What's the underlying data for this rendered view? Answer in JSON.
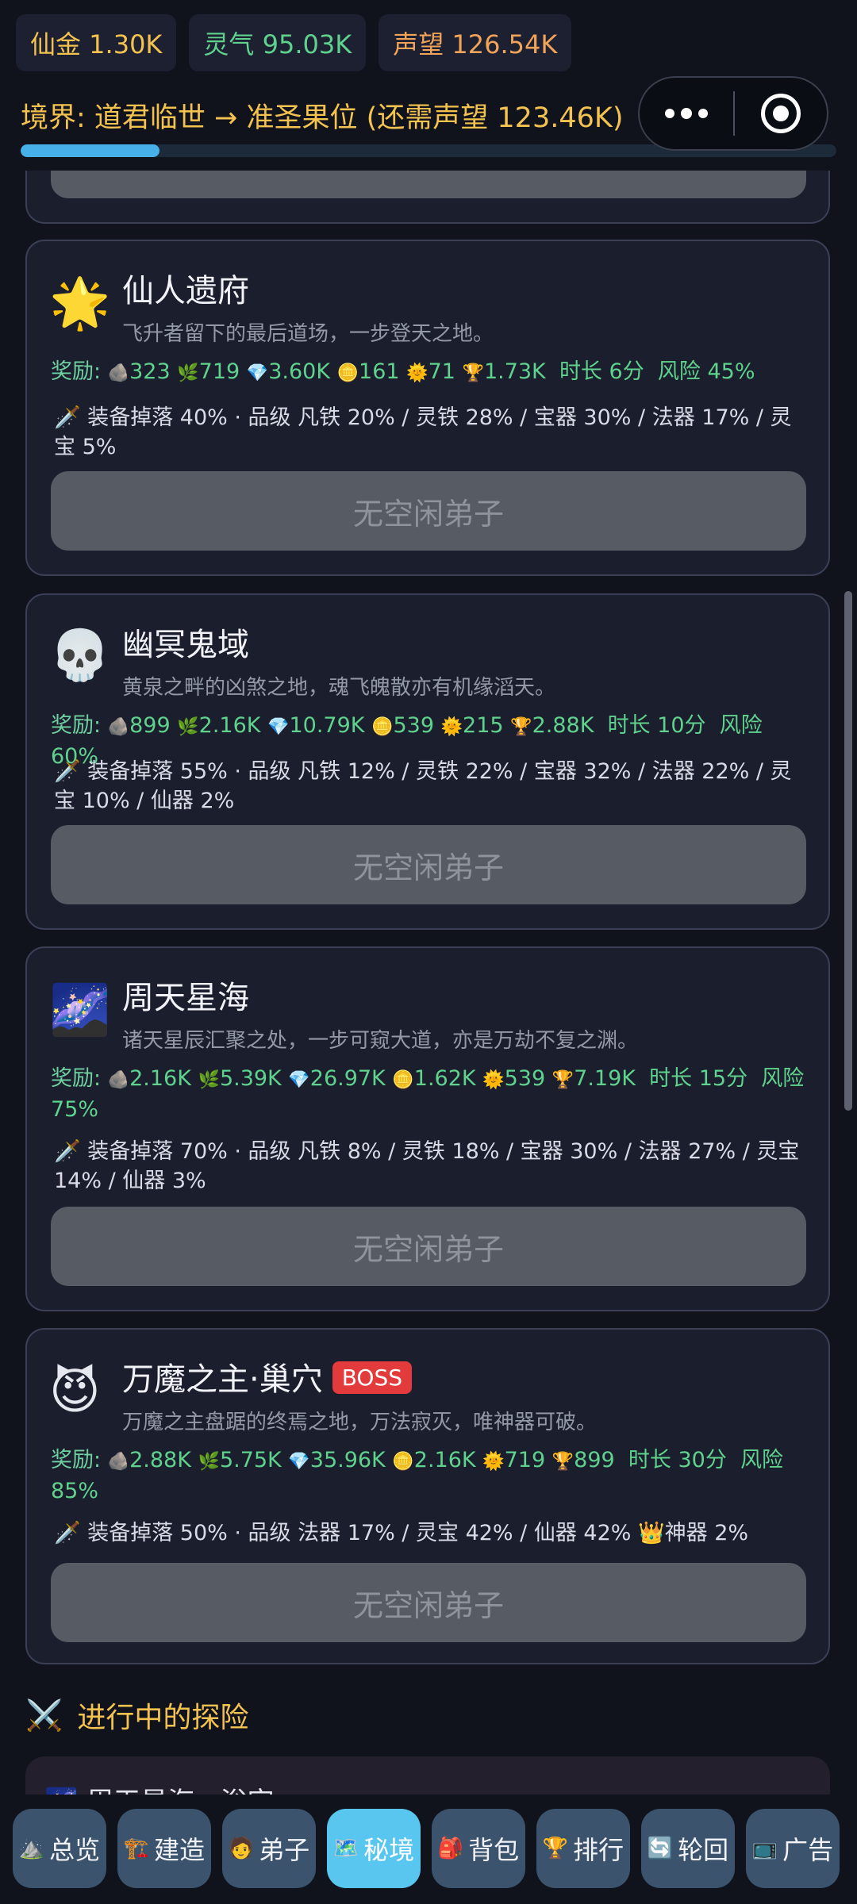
{
  "resources": [
    {
      "label": "仙金 1.30K",
      "color": "gold"
    },
    {
      "label": "灵气 95.03K",
      "color": "green"
    },
    {
      "label": "声望 126.54K",
      "color": "orange"
    }
  ],
  "realm": {
    "text": "境界: 道君临世 → 准圣果位 (还需声望 123.46K)",
    "progress_percent": 17
  },
  "busy_label": "无空闲弟子",
  "realms": [
    {
      "icon": "🌟",
      "icon_name": "glowing-star-icon",
      "title": "仙人遗府",
      "desc": "飞升者留下的最后道场，一步登天之地。",
      "reward_label": "奖励:",
      "rewards": [
        {
          "icon": "🪨",
          "value": "323"
        },
        {
          "icon": "🌿",
          "value": "719"
        },
        {
          "icon": "💎",
          "value": "3.60K"
        },
        {
          "icon": "🪙",
          "value": "161"
        },
        {
          "icon": "🌞",
          "value": "71"
        },
        {
          "icon": "🏆",
          "value": "1.73K"
        }
      ],
      "duration": "时长 6分",
      "risk": "风险 45%",
      "drop": "🗡️ 装备掉落 40% · 品级 凡铁 20% / 灵铁 28% / 宝器 30% / 法器 17% / 灵宝 5%"
    },
    {
      "icon": "💀",
      "icon_name": "skull-icon",
      "title": "幽冥鬼域",
      "desc": "黄泉之畔的凶煞之地，魂飞魄散亦有机缘滔天。",
      "reward_label": "奖励:",
      "rewards": [
        {
          "icon": "🪨",
          "value": "899"
        },
        {
          "icon": "🌿",
          "value": "2.16K"
        },
        {
          "icon": "💎",
          "value": "10.79K"
        },
        {
          "icon": "🪙",
          "value": "539"
        },
        {
          "icon": "🌞",
          "value": "215"
        },
        {
          "icon": "🏆",
          "value": "2.88K"
        }
      ],
      "duration": "时长 10分",
      "risk": "风险 60%",
      "drop": "🗡️ 装备掉落 55% · 品级 凡铁 12% / 灵铁 22% / 宝器 32% / 法器 22% / 灵宝 10% / 仙器 2%"
    },
    {
      "icon": "🌌",
      "icon_name": "galaxy-icon",
      "title": "周天星海",
      "desc": "诸天星辰汇聚之处，一步可窥大道，亦是万劫不复之渊。",
      "reward_label": "奖励:",
      "rewards": [
        {
          "icon": "🪨",
          "value": "2.16K"
        },
        {
          "icon": "🌿",
          "value": "5.39K"
        },
        {
          "icon": "💎",
          "value": "26.97K"
        },
        {
          "icon": "🪙",
          "value": "1.62K"
        },
        {
          "icon": "🌞",
          "value": "539"
        },
        {
          "icon": "🏆",
          "value": "7.19K"
        }
      ],
      "duration": "时长 15分",
      "risk": "风险 75%",
      "drop": "🗡️ 装备掉落 70% · 品级 凡铁 8% / 灵铁 18% / 宝器 30% / 法器 27% / 灵宝 14% / 仙器 3%"
    },
    {
      "icon": "😈",
      "icon_name": "devil-icon",
      "title": "万魔之主·巢穴",
      "badge": "BOSS",
      "desc": "万魔之主盘踞的终焉之地，万法寂灭，唯神器可破。",
      "reward_label": "奖励:",
      "rewards": [
        {
          "icon": "🪨",
          "value": "2.88K"
        },
        {
          "icon": "🌿",
          "value": "5.75K"
        },
        {
          "icon": "💎",
          "value": "35.96K"
        },
        {
          "icon": "🪙",
          "value": "2.16K"
        },
        {
          "icon": "🌞",
          "value": "719"
        },
        {
          "icon": "🏆",
          "value": "899"
        }
      ],
      "duration": "时长 30分",
      "risk": "风险 85%",
      "drop": "🗡️ 装备掉落 50% · 品级 法器 17% / 灵宝 42% / 仙器 42% 👑神器 2%"
    }
  ],
  "section": {
    "icon": "⚔️",
    "title": "进行中的探险"
  },
  "ongoing": {
    "title": "🌌 周天星海 · 浴宫"
  },
  "nav": [
    {
      "icon": "⛰️",
      "label": "总览",
      "active": false
    },
    {
      "icon": "🏗️",
      "label": "建造",
      "active": false
    },
    {
      "icon": "🧑",
      "label": "弟子",
      "active": false
    },
    {
      "icon": "🗺️",
      "label": "秘境",
      "active": true
    },
    {
      "icon": "🎒",
      "label": "背包",
      "active": false
    },
    {
      "icon": "🏆",
      "label": "排行",
      "active": false
    },
    {
      "icon": "🔄",
      "label": "轮回",
      "active": false
    },
    {
      "icon": "📺",
      "label": "广告",
      "active": false
    }
  ]
}
